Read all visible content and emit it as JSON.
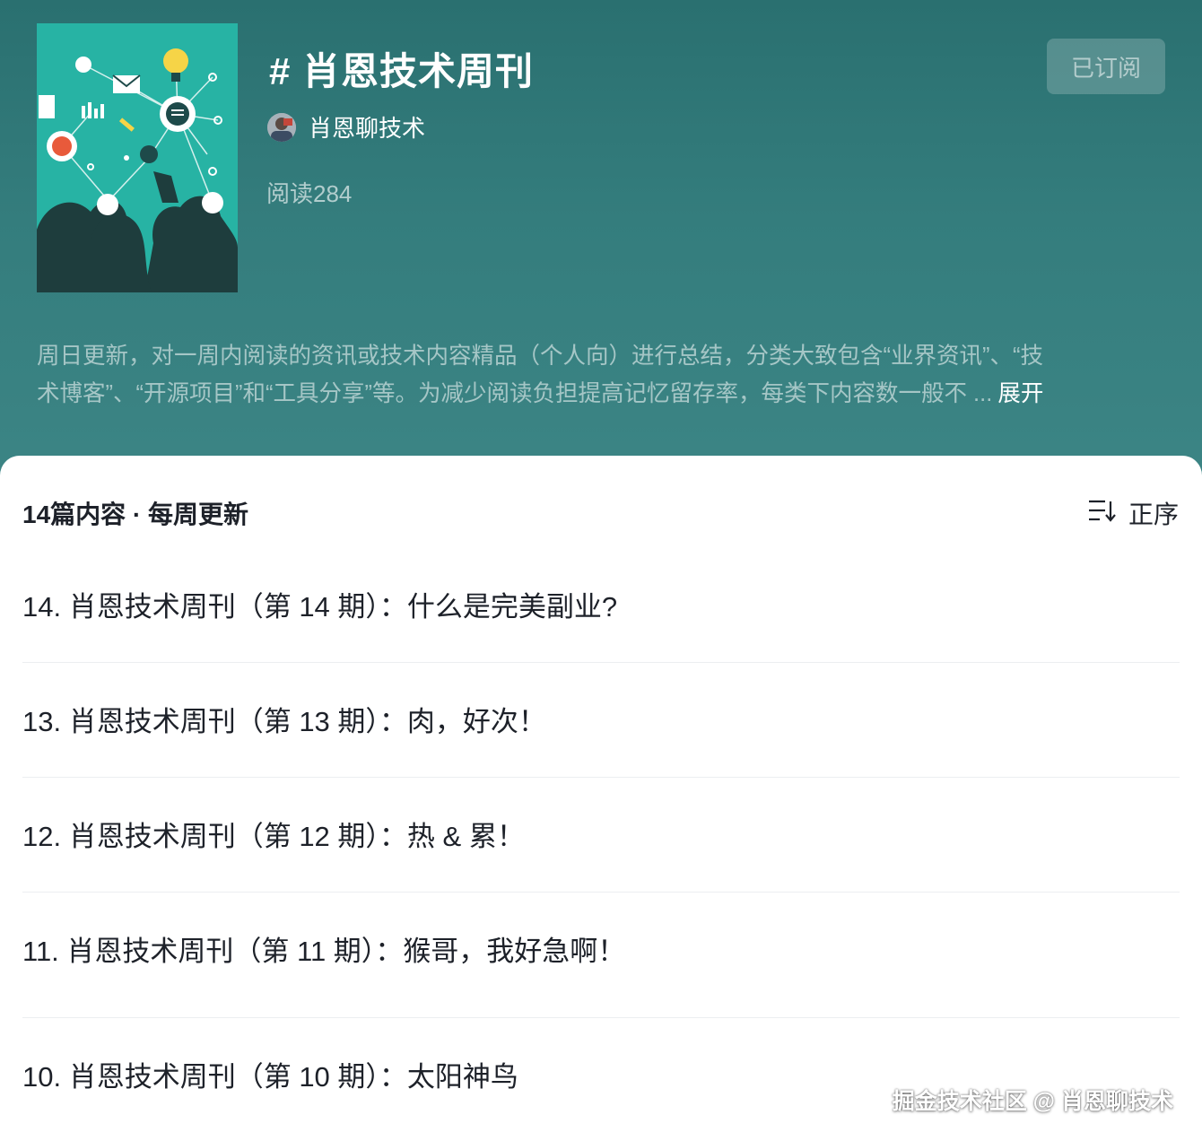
{
  "header": {
    "title": "# 肖恩技术周刊",
    "author": "肖恩聊技术",
    "reads": "阅读284",
    "subscribe_label": "已订阅",
    "description_line1": "周日更新，对一周内阅读的资讯或技术内容精品（个人向）进行总结，分类大致包含“业界资讯”、“技",
    "description_line2": "术博客”、“开源项目”和“工具分享”等。为减少阅读负担提高记忆留存率，每类下内容数一般不 ...",
    "expand_label": "展开"
  },
  "list": {
    "meta": "14篇内容 · 每周更新",
    "sort_label": "正序",
    "articles": [
      "14. 肖恩技术周刊（第 14 期）：什么是完美副业?",
      "13. 肖恩技术周刊（第 13 期）：肉，好次！",
      "12. 肖恩技术周刊（第 12 期）：热 & 累！",
      "11. 肖恩技术周刊（第 11 期）：猴哥，我好急啊！",
      "10. 肖恩技术周刊（第 10 期）：太阳神鸟"
    ]
  },
  "watermark": "掘金技术社区 @ 肖恩聊技术",
  "colors": {
    "header_bg": "#2c7474",
    "cover_bg": "#27b3a4",
    "text_dark": "#1d2129"
  },
  "icons": [
    "sort-icon",
    "avatar",
    "cover-image"
  ]
}
